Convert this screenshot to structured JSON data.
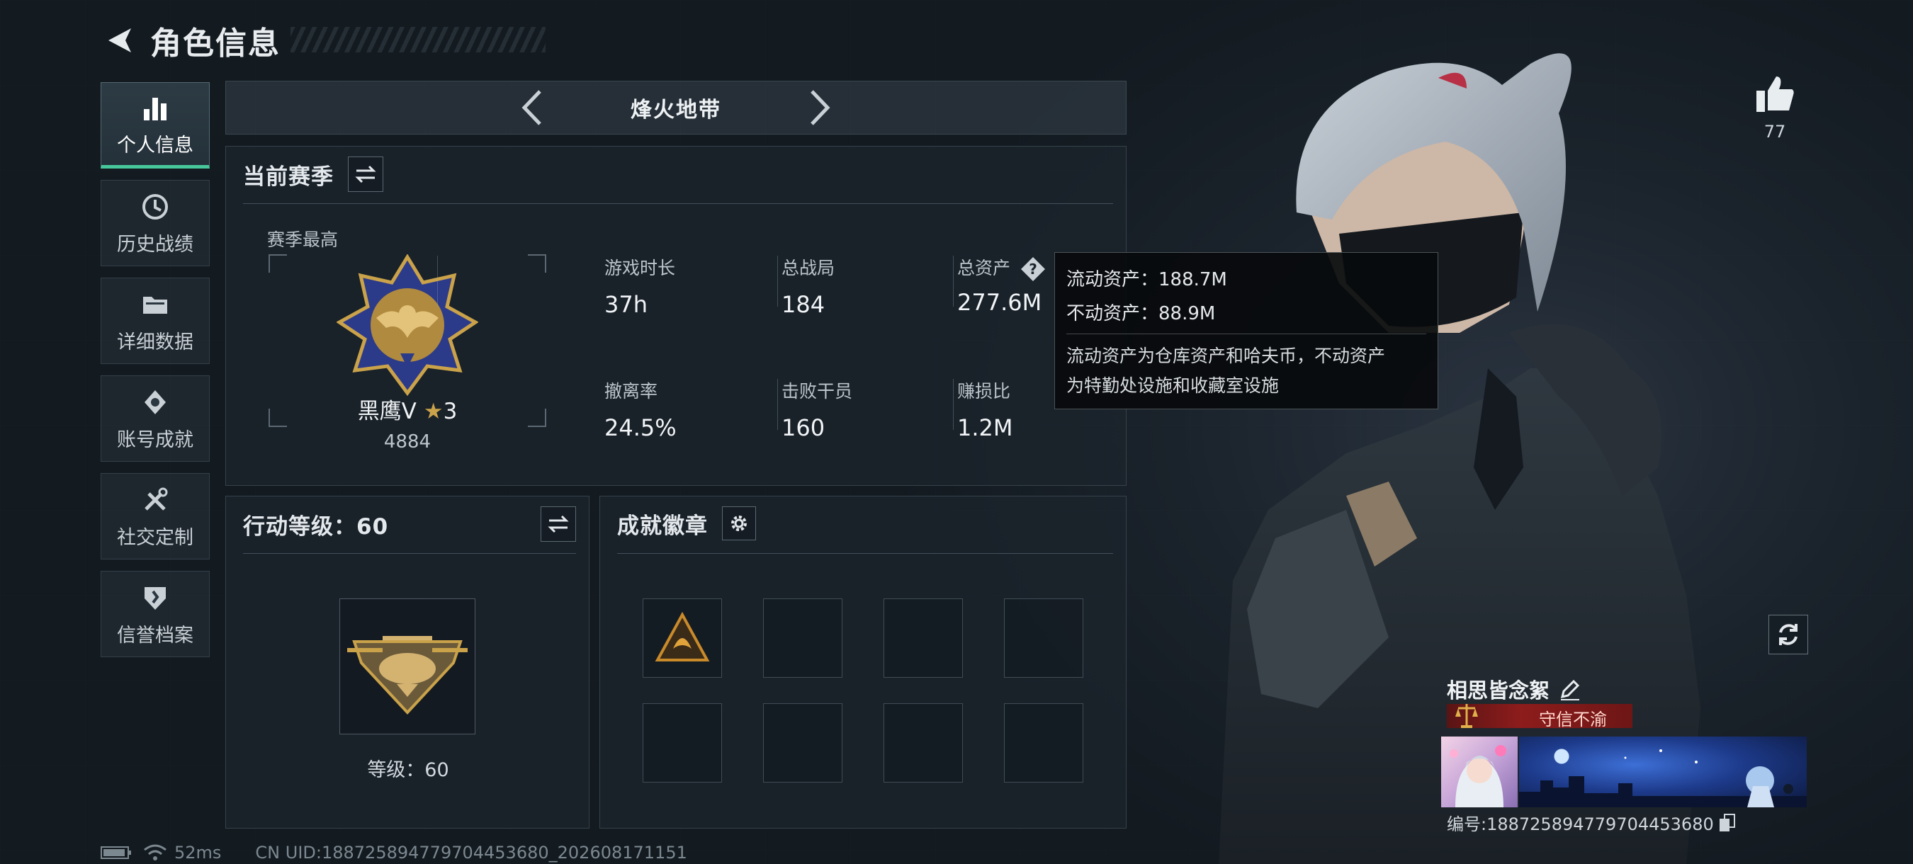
{
  "header": {
    "title": "角色信息"
  },
  "sidebar": {
    "items": [
      {
        "label": "个人信息",
        "icon": "bar-chart-icon",
        "active": true
      },
      {
        "label": "历史战绩",
        "icon": "history-icon"
      },
      {
        "label": "详细数据",
        "icon": "folder-icon"
      },
      {
        "label": "账号成就",
        "icon": "achievement-icon"
      },
      {
        "label": "社交定制",
        "icon": "tools-icon"
      },
      {
        "label": "信誉档案",
        "icon": "credit-shield-icon"
      }
    ]
  },
  "mode": {
    "name": "烽火地带"
  },
  "season": {
    "title": "当前赛季",
    "best_label": "赛季最高",
    "rank_name": "黑鹰Ⅴ",
    "rank_stars": "3",
    "rank_score": "4884",
    "stats": [
      {
        "label": "游戏时长",
        "value": "37h"
      },
      {
        "label": "总战局",
        "value": "184"
      },
      {
        "label": "总资产",
        "value": "277.6M"
      },
      {
        "label": "撤离率",
        "value": "24.5%"
      },
      {
        "label": "击败干员",
        "value": "160"
      },
      {
        "label": "赚损比",
        "value": "1.2M"
      }
    ]
  },
  "level_panel": {
    "title": "行动等级：60",
    "level_text": "等级：60"
  },
  "achievements": {
    "title": "成就徽章"
  },
  "tooltip": {
    "liquid": "流动资产：188.7M",
    "fixed": "不动资产：88.9M",
    "desc_line1": "流动资产为仓库资产和哈夫币，不动资产",
    "desc_line2": "为特勤处设施和收藏室设施"
  },
  "likes": {
    "count": "77"
  },
  "profile": {
    "name": "相思皆念絮",
    "title_badge": "守信不渝",
    "uid_label": "编号:188725894779704453680"
  },
  "footer": {
    "ping": "52ms",
    "uid": "CN UID:188725894779704453680_202608171151"
  },
  "colors": {
    "accent": "#47c89a",
    "title_bar": "#8d1c1c",
    "gold": "#c9a24a"
  }
}
